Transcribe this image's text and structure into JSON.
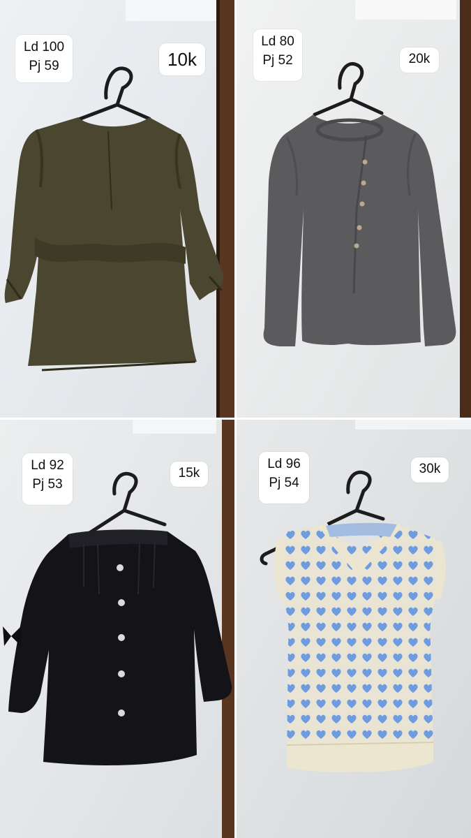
{
  "items": [
    {
      "ld": "Ld 100",
      "pj": "Pj 59",
      "price": "10k",
      "garment": "olive-ruffle-blouse",
      "color": "#4a4630"
    },
    {
      "ld": "Ld 80",
      "pj": "Pj 52",
      "price": "20k",
      "garment": "grey-knit-cardigan",
      "color": "#5b5b5d"
    },
    {
      "ld": "Ld 92",
      "pj": "Pj 53",
      "price": "15k",
      "garment": "black-buttoned-blouse",
      "color": "#141418"
    },
    {
      "ld": "Ld 96",
      "pj": "Pj 54",
      "price": "30k",
      "garment": "blue-heart-sweater-vest",
      "color": "#7ea3d8"
    }
  ],
  "colors": {
    "wall": "#e9ecef",
    "door_frame": "#5a3620",
    "hanger": "#1c1c1e",
    "label_bg": "#ffffff"
  }
}
